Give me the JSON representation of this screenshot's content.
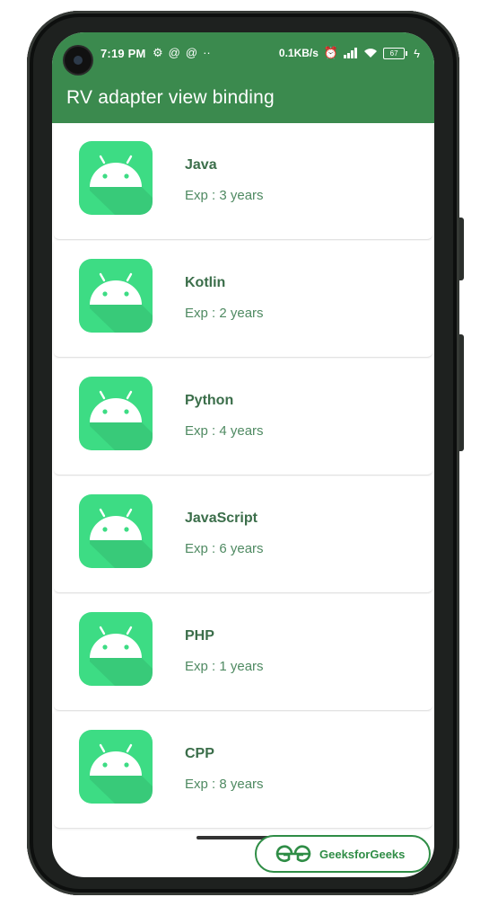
{
  "status": {
    "time": "7:19 PM",
    "net_speed": "0.1KB/s",
    "battery": "67"
  },
  "appbar": {
    "title": "RV adapter view binding"
  },
  "items": [
    {
      "name": "Java",
      "exp": "Exp : 3 years"
    },
    {
      "name": "Kotlin",
      "exp": "Exp : 2 years"
    },
    {
      "name": "Python",
      "exp": "Exp : 4 years"
    },
    {
      "name": "JavaScript",
      "exp": "Exp : 6 years"
    },
    {
      "name": "PHP",
      "exp": "Exp : 1 years"
    },
    {
      "name": "CPP",
      "exp": "Exp : 8 years"
    }
  ],
  "watermark": {
    "text": "GeeksforGeeks"
  },
  "colors": {
    "primary": "#3b8a4e",
    "icon_bg": "#3ddc84",
    "title_text": "#3b6e4a",
    "gfg_green": "#2f8d46"
  },
  "icons": {
    "list_item": "android-icon",
    "status": [
      "gear-icon",
      "at-icon",
      "at-icon",
      "more-icon",
      "alarm-icon",
      "signal-icon",
      "wifi-icon",
      "battery-icon",
      "charging-icon"
    ]
  }
}
